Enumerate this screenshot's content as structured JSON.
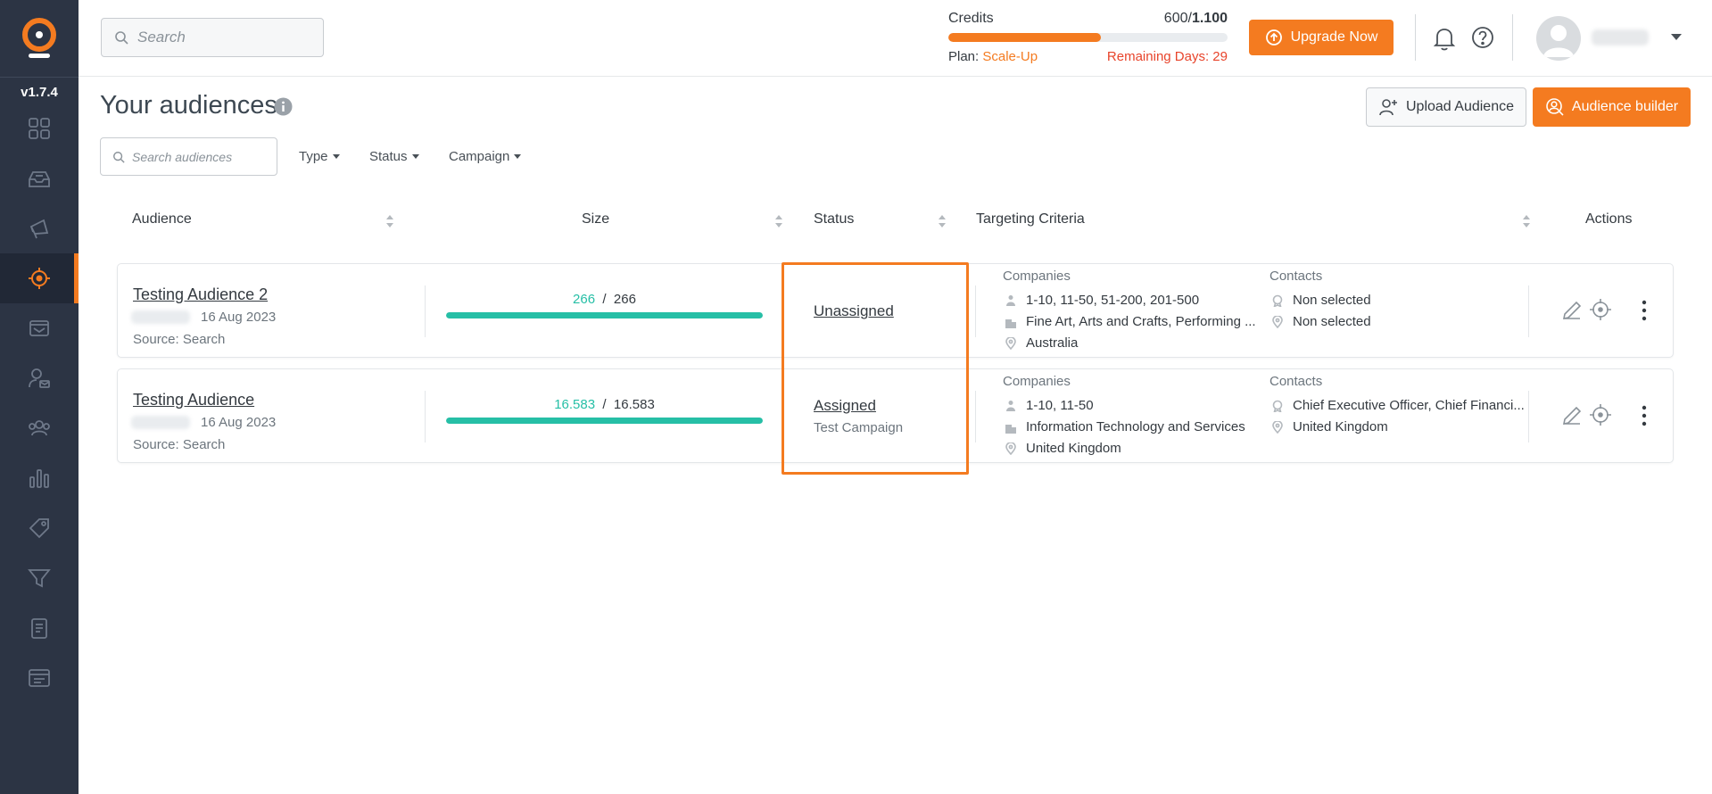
{
  "app": {
    "version": "v1.7.4",
    "search_placeholder": "Search"
  },
  "credits": {
    "label": "Credits",
    "used": "600",
    "total": "1.100",
    "used_fraction": 0.545,
    "plan_label": "Plan:",
    "plan_name": "Scale-Up",
    "remaining": "Remaining Days: 29"
  },
  "header": {
    "upgrade_label": "Upgrade Now"
  },
  "page": {
    "title": "Your audiences",
    "upload_label": "Upload Audience",
    "builder_label": "Audience builder",
    "search_placeholder": "Search audiences",
    "filters": [
      "Type",
      "Status",
      "Campaign"
    ]
  },
  "table": {
    "headers": {
      "audience": "Audience",
      "size": "Size",
      "status": "Status",
      "targeting": "Targeting Criteria",
      "actions": "Actions"
    },
    "rows": [
      {
        "name": "Testing Audience 2",
        "date": "16 Aug 2023",
        "source": "Source: Search",
        "size_current": "266",
        "size_total": "266",
        "size_fraction": 1.0,
        "status": "Unassigned",
        "status_sub": "",
        "companies_label": "Companies",
        "companies": [
          "1-10, 11-50, 51-200, 201-500",
          "Fine Art, Arts and Crafts, Performing ...",
          "Australia"
        ],
        "contacts_label": "Contacts",
        "contacts": [
          "Non selected",
          "Non selected"
        ]
      },
      {
        "name": "Testing Audience",
        "date": "16 Aug 2023",
        "source": "Source: Search",
        "size_current": "16.583",
        "size_total": "16.583",
        "size_fraction": 1.0,
        "status": "Assigned",
        "status_sub": "Test Campaign",
        "companies_label": "Companies",
        "companies": [
          "1-10, 11-50",
          "Information Technology and Services",
          "United Kingdom"
        ],
        "contacts_label": "Contacts",
        "contacts": [
          "Chief Executive Officer, Chief Financi...",
          "United Kingdom"
        ]
      }
    ]
  },
  "colors": {
    "accent": "#f47b20",
    "sidebar": "#2c3444",
    "size_bar": "#26bfa6",
    "remaining": "#e8442b"
  }
}
